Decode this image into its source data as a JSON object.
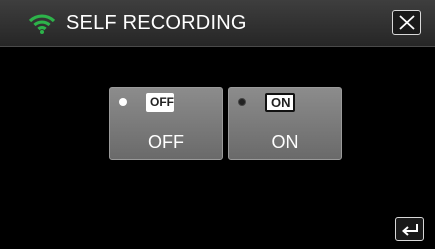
{
  "header": {
    "title": "SELF RECORDING",
    "wifi_icon": "wifi-icon",
    "close_icon": "close-icon"
  },
  "options": [
    {
      "badge": "OFF",
      "label": "OFF",
      "selected": true
    },
    {
      "badge": "ON",
      "label": "ON",
      "selected": false
    }
  ],
  "footer": {
    "back_icon": "back-arrow-icon"
  },
  "colors": {
    "accent": "#2db34a",
    "background": "#000000",
    "button": "#7a7a7a"
  }
}
